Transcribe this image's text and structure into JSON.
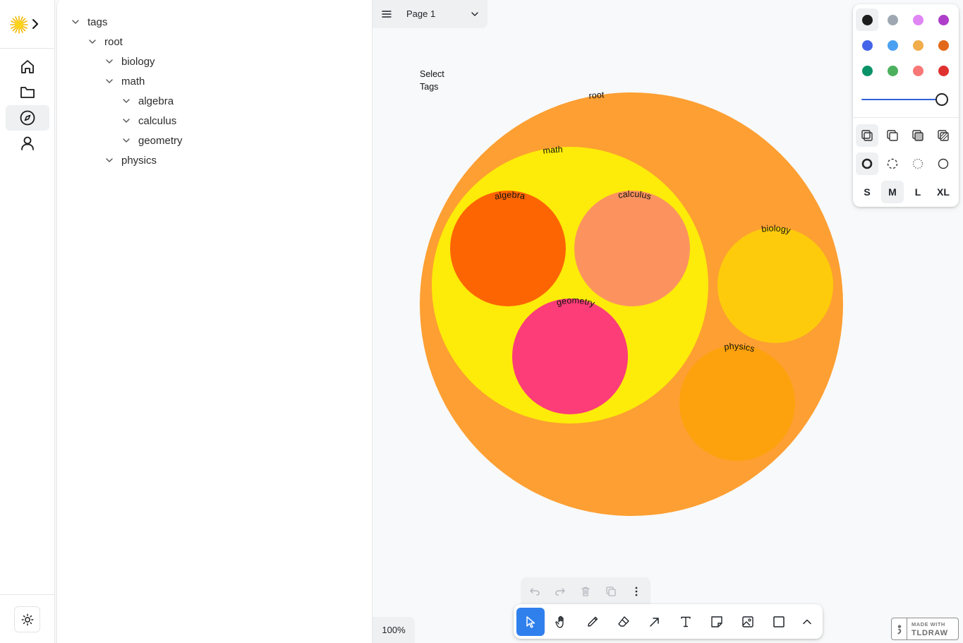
{
  "sidebar": {
    "logo": "sun-logo-icon",
    "nav": [
      {
        "icon": "home-icon",
        "active": false
      },
      {
        "icon": "folder-icon",
        "active": false
      },
      {
        "icon": "compass-icon",
        "active": true
      },
      {
        "icon": "user-icon",
        "active": false
      }
    ],
    "theme_icon": "sun-icon"
  },
  "tree": {
    "items": [
      {
        "label": "tags",
        "depth": 0
      },
      {
        "label": "root",
        "depth": 1
      },
      {
        "label": "biology",
        "depth": 2
      },
      {
        "label": "math",
        "depth": 2
      },
      {
        "label": "algebra",
        "depth": 3
      },
      {
        "label": "calculus",
        "depth": 3
      },
      {
        "label": "geometry",
        "depth": 3
      },
      {
        "label": "physics",
        "depth": 2
      }
    ]
  },
  "page_menu": {
    "label": "Page 1"
  },
  "canvas": {
    "select_tags_text": "Select Tags",
    "bubbles": [
      {
        "label": "root",
        "color": "#fd9f32"
      },
      {
        "label": "math",
        "color": "#fdeb09"
      },
      {
        "label": "algebra",
        "color": "#fd6503"
      },
      {
        "label": "calculus",
        "color": "#fc935f"
      },
      {
        "label": "geometry",
        "color": "#fc3d78"
      },
      {
        "label": "biology",
        "color": "#fdcb0c"
      },
      {
        "label": "physics",
        "color": "#fda20d"
      }
    ]
  },
  "style_panel": {
    "colors": [
      "#1d1d1d",
      "#9fa8b2",
      "#e085f4",
      "#ae3ec9",
      "#4465e9",
      "#4ba1f1",
      "#f1ac4b",
      "#e16919",
      "#099268",
      "#4cb05e",
      "#f87777",
      "#e03131"
    ],
    "selected_color_index": 0,
    "opacity": 1,
    "fill_options": [
      "fill-none-icon",
      "fill-semi-icon",
      "fill-solid-icon",
      "fill-pattern-icon"
    ],
    "dash_options": [
      "dash-draw-icon",
      "dash-dashed-icon",
      "dash-dotted-icon",
      "dash-solid-icon"
    ],
    "sizes": [
      "S",
      "M",
      "L",
      "XL"
    ],
    "selected_size": "M"
  },
  "zoom": {
    "label": "100%"
  },
  "actions": [
    "undo-icon",
    "redo-icon",
    "trash-icon",
    "duplicate-icon",
    "more-icon"
  ],
  "toolbar": {
    "tools": [
      "select-icon",
      "hand-icon",
      "draw-icon",
      "eraser-icon",
      "arrow-icon",
      "text-icon",
      "note-icon",
      "image-icon",
      "rectangle-icon",
      "more-tools-icon"
    ],
    "selected": "select-icon"
  },
  "watermark": {
    "line1": "MADE WITH",
    "line2": "TLDRAW"
  }
}
